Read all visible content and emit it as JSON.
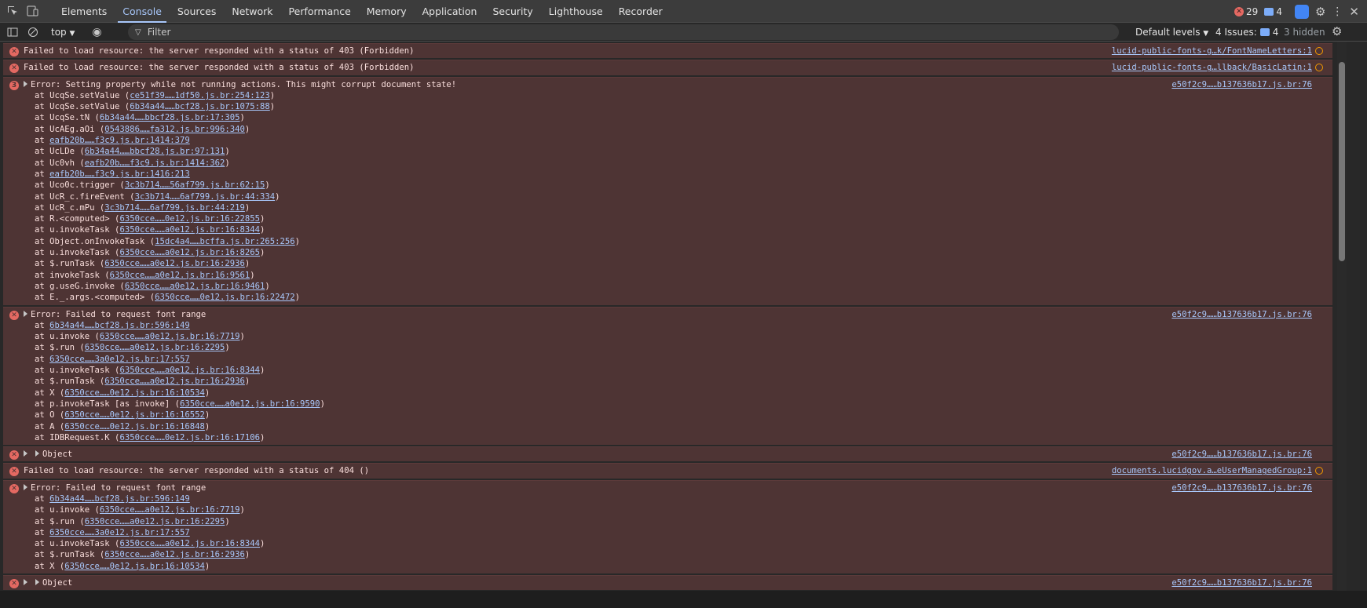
{
  "topbar": {
    "tabs": [
      "Elements",
      "Console",
      "Sources",
      "Network",
      "Performance",
      "Memory",
      "Application",
      "Security",
      "Lighthouse",
      "Recorder"
    ],
    "active_tab": 1,
    "error_count": "29",
    "message_count": "4"
  },
  "console_toolbar": {
    "context": "top",
    "filter_placeholder": "Filter",
    "levels": "Default levels",
    "issues_label": "4 Issues:",
    "issues_count": "4",
    "hidden": "3 hidden"
  },
  "entries": [
    {
      "type": "error",
      "message": "Failed to load resource: the server responded with a status of 403 (Forbidden)",
      "source": "lucid-public-fonts-g…k/FontNameLetters:1",
      "frames": []
    },
    {
      "type": "error",
      "message": "Failed to load resource: the server responded with a status of 403 (Forbidden)",
      "source": "lucid-public-fonts-g…llback/BasicLatin:1",
      "frames": []
    },
    {
      "type": "error-group",
      "count": "3",
      "message": "Error: Setting property while not running actions. This might corrupt document state!",
      "source": "e50f2c9……b137636b17.js.br:76",
      "frames": [
        [
          "at UcqSe.setValue (",
          "ce51f39……1df50.js.br:254:123",
          ")"
        ],
        [
          "at UcqSe.setValue (",
          "6b34a44……bcf28.js.br:1075:88",
          ")"
        ],
        [
          "at UcqSe.tN (",
          "6b34a44……bbcf28.js.br:17:305",
          ")"
        ],
        [
          "at UcAEg.aOi (",
          "0543886……fa312.js.br:996:340",
          ")"
        ],
        [
          "at ",
          "eafb20b……f3c9.js.br:1414:379",
          ""
        ],
        [
          "at UcLDe (",
          "6b34a44……bbcf28.js.br:97:131",
          ")"
        ],
        [
          "at Uc0vh (",
          "eafb20b……f3c9.js.br:1414:362",
          ")"
        ],
        [
          "at ",
          "eafb20b……f3c9.js.br:1416:213",
          ""
        ],
        [
          "at Uco0c.trigger (",
          "3c3b714……56af799.js.br:62:15",
          ")"
        ],
        [
          "at UcR_c.fireEvent (",
          "3c3b714……6af799.js.br:44:334",
          ")"
        ],
        [
          "at UcR_c.mPu (",
          "3c3b714……6af799.js.br:44:219",
          ")"
        ],
        [
          "at R.<computed> (",
          "6350cce……0e12.js.br:16:22855",
          ")"
        ],
        [
          "at u.invokeTask (",
          "6350cce……a0e12.js.br:16:8344",
          ")"
        ],
        [
          "at Object.onInvokeTask (",
          "15dc4a4……bcffa.js.br:265:256",
          ")"
        ],
        [
          "at u.invokeTask (",
          "6350cce……a0e12.js.br:16:8265",
          ")"
        ],
        [
          "at $.runTask (",
          "6350cce……a0e12.js.br:16:2936",
          ")"
        ],
        [
          "at invokeTask (",
          "6350cce……a0e12.js.br:16:9561",
          ")"
        ],
        [
          "at g.useG.invoke (",
          "6350cce……a0e12.js.br:16:9461",
          ")"
        ],
        [
          "at E._.args.<computed> (",
          "6350cce……0e12.js.br:16:22472",
          ")"
        ]
      ]
    },
    {
      "type": "error-expand",
      "message": "Error: Failed to request font range",
      "source": "e50f2c9……b137636b17.js.br:76",
      "frames": [
        [
          "at ",
          "6b34a44……bcf28.js.br:596:149",
          ""
        ],
        [
          "at u.invoke (",
          "6350cce……a0e12.js.br:16:7719",
          ")"
        ],
        [
          "at $.run (",
          "6350cce……a0e12.js.br:16:2295",
          ")"
        ],
        [
          "at ",
          "6350cce……3a0e12.js.br:17:557",
          ""
        ],
        [
          "at u.invokeTask (",
          "6350cce……a0e12.js.br:16:8344",
          ")"
        ],
        [
          "at $.runTask (",
          "6350cce……a0e12.js.br:16:2936",
          ")"
        ],
        [
          "at X (",
          "6350cce……0e12.js.br:16:10534",
          ")"
        ],
        [
          "at p.invokeTask [as invoke] (",
          "6350cce……a0e12.js.br:16:9590",
          ")"
        ],
        [
          "at O (",
          "6350cce……0e12.js.br:16:16552",
          ")"
        ],
        [
          "at A (",
          "6350cce……0e12.js.br:16:16848",
          ")"
        ],
        [
          "at IDBRequest.K (",
          "6350cce……0e12.js.br:16:17106",
          ")"
        ]
      ]
    },
    {
      "type": "object",
      "message": "Object",
      "source": "e50f2c9……b137636b17.js.br:76",
      "frames": []
    },
    {
      "type": "error",
      "message": "Failed to load resource: the server responded with a status of 404 ()",
      "source": "documents.lucidgov.a…eUserManagedGroup:1",
      "frames": []
    },
    {
      "type": "error-expand",
      "message": "Error: Failed to request font range",
      "source": "e50f2c9……b137636b17.js.br:76",
      "frames": [
        [
          "at ",
          "6b34a44……bcf28.js.br:596:149",
          ""
        ],
        [
          "at u.invoke (",
          "6350cce……a0e12.js.br:16:7719",
          ")"
        ],
        [
          "at $.run (",
          "6350cce……a0e12.js.br:16:2295",
          ")"
        ],
        [
          "at ",
          "6350cce……3a0e12.js.br:17:557",
          ""
        ],
        [
          "at u.invokeTask (",
          "6350cce……a0e12.js.br:16:8344",
          ")"
        ],
        [
          "at $.runTask (",
          "6350cce……a0e12.js.br:16:2936",
          ")"
        ],
        [
          "at X (",
          "6350cce……0e12.js.br:16:10534",
          ")"
        ]
      ]
    },
    {
      "type": "object",
      "message": "Object",
      "source": "e50f2c9……b137636b17.js.br:76",
      "frames": []
    }
  ]
}
